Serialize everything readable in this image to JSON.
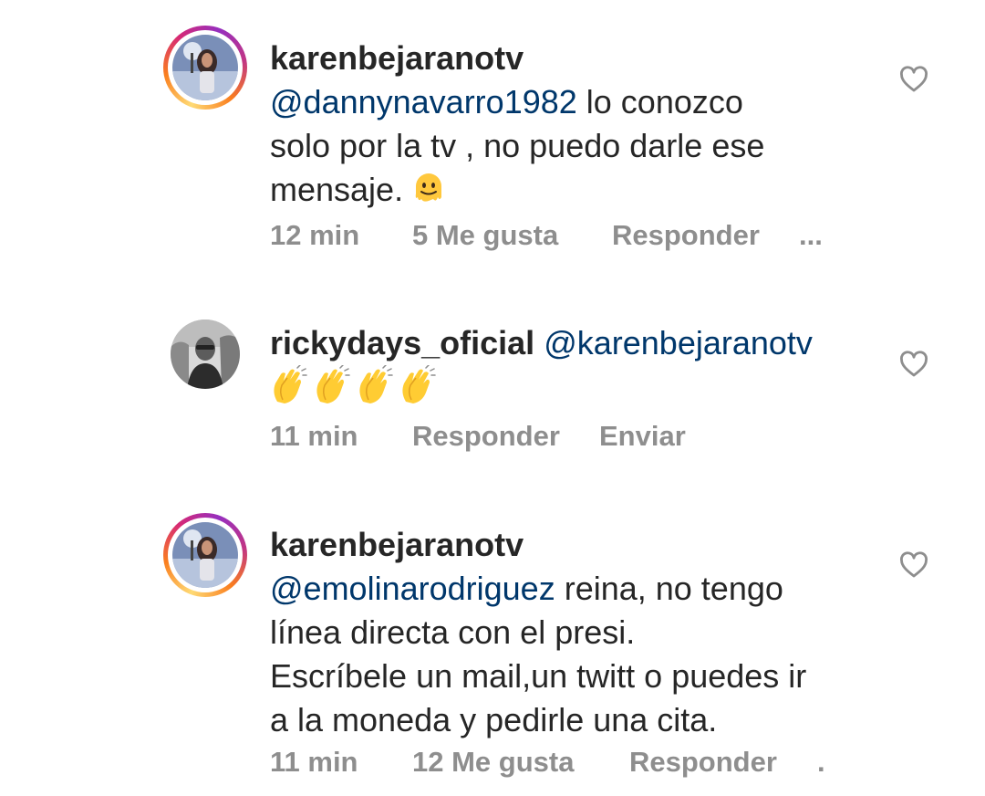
{
  "comments": [
    {
      "username": "karenbejaranotv",
      "mention": "@dannynavarro1982",
      "text_lines": [
        " lo conozco",
        "solo por la tv , no puedo darle ese",
        "mensaje."
      ],
      "emoji": "melting-face",
      "time": "12 min",
      "likes": "5 Me gusta",
      "reply": "Responder",
      "more": "..."
    },
    {
      "username": "rickydays_oficial",
      "mention": "@karenbejaranotv",
      "emoji": "clapping-hands x4",
      "time": "11 min",
      "reply": "Responder",
      "send": "Enviar"
    },
    {
      "username": "karenbejaranotv",
      "mention": "@emolinarodriguez",
      "text_lines": [
        " reina, no tengo",
        "línea directa con el presi.",
        "Escríbele un mail,un twitt o puedes ir",
        "a la moneda y pedirle una cita."
      ],
      "time": "11 min",
      "likes": "12 Me gusta",
      "reply": "Responder",
      "more": "."
    }
  ],
  "colors": {
    "username": "#262626",
    "mention": "#00376b",
    "meta": "#8e8e8e",
    "heart": "#8e8e8e"
  },
  "icons": [
    "heart-outline-icon",
    "melting-face-emoji",
    "clapping-hands-emoji"
  ]
}
